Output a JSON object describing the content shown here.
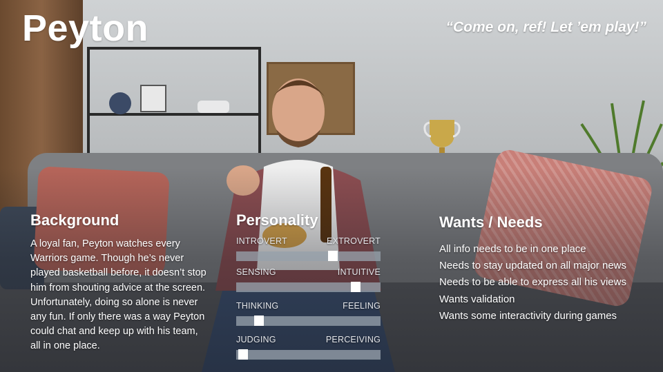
{
  "persona": {
    "name": "Peyton",
    "quote": "“Come on, ref! Let ’em play!”"
  },
  "background": {
    "heading": "Background",
    "text": "A loyal fan, Peyton watches every Warriors game. Though he’s never played basketball before, it doesn’t stop him from shouting advice at the screen. Unfortunately, doing so alone is never any fun. If only there was a way Peyton could chat and keep up with his team, all in one place."
  },
  "personality": {
    "heading": "Personality",
    "traits": [
      {
        "left": "INTROVERT",
        "right": "EXTROVERT",
        "value": 0.67
      },
      {
        "left": "SENSING",
        "right": "INTUITIVE",
        "value": 0.83
      },
      {
        "left": "THINKING",
        "right": "FEELING",
        "value": 0.16
      },
      {
        "left": "JUDGING",
        "right": "PERCEIVING",
        "value": 0.05
      }
    ]
  },
  "wants": {
    "heading": "Wants / Needs",
    "items": [
      "All info needs to be in one place",
      "Needs to stay updated on all major news",
      "Needs to be able to express all his views",
      "Wants validation",
      "Wants some interactivity during games"
    ]
  }
}
